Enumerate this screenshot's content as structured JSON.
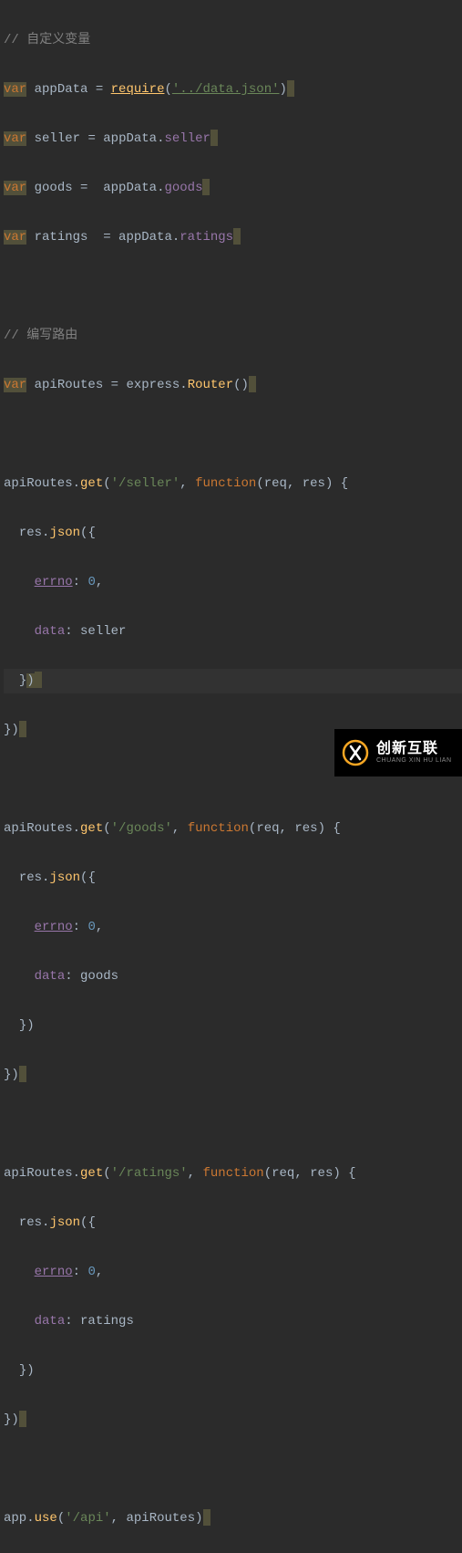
{
  "code": {
    "comment1": "// 自定义变量",
    "var": "var",
    "appData": "appData",
    "eq": " = ",
    "require": "require",
    "requirePath": "'../data.json'",
    "seller": "seller",
    "sellerExpr": "appData.seller",
    "goods": "goods",
    "goodsExpr": "appData.goods",
    "ratings": "ratings",
    "ratingsExpr": "appData.ratings",
    "comment2": "// 编写路由",
    "apiRoutes": "apiRoutes",
    "express": "express",
    "Router": "Router",
    "get": "get",
    "sellerRoute": "'/seller'",
    "goodsRoute": "'/goods'",
    "ratingsRoute": "'/ratings'",
    "function": "function",
    "req": "req",
    "res": "res",
    "json": "json",
    "errno": "errno",
    "zero": "0",
    "data": "data",
    "app": "app",
    "use": "use",
    "apiPath": "'/api'",
    "comma": ", ",
    "dot": ".",
    "colon": ": "
  },
  "watermark": {
    "cn": "创新互联",
    "en": "CHUANG XIN HU LIAN"
  }
}
